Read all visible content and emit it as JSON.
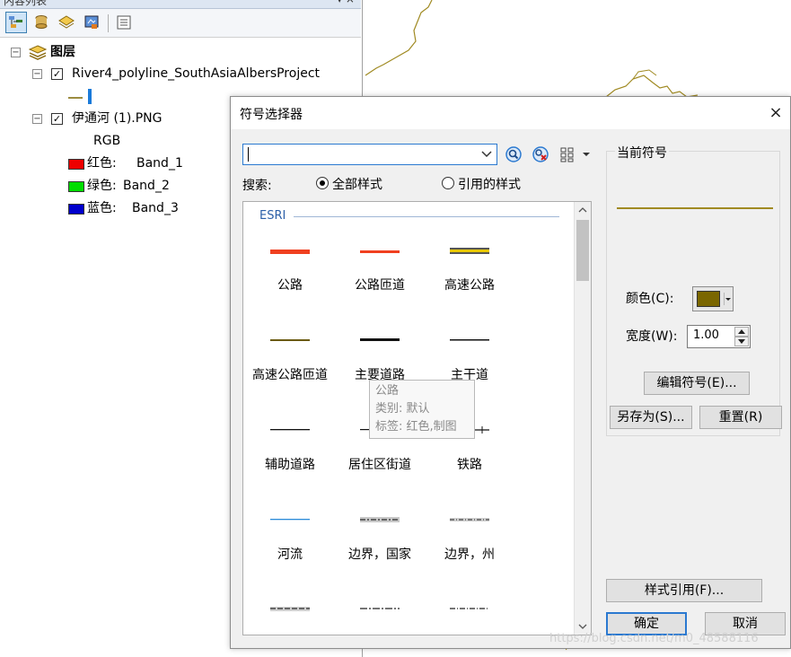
{
  "toc": {
    "title": "内容列表",
    "root_label": "图层",
    "layer1_name": "River4_polyline_SouthAsiaAlbersProject",
    "layer2_name": "伊通河 (1).PNG",
    "rgb_label": "RGB",
    "bands": [
      {
        "label": "红色:",
        "band": "Band_1",
        "color": "#ee0000"
      },
      {
        "label": "绿色:",
        "band": "Band_2",
        "color": "#00dd00"
      },
      {
        "label": "蓝色:",
        "band": "Band_3",
        "color": "#0000cc"
      }
    ]
  },
  "dialog": {
    "title": "符号选择器",
    "close": "×",
    "search_value": "",
    "search_label": "搜索:",
    "radio_all": "全部样式",
    "radio_referenced": "引用的样式",
    "group_name": "ESRI",
    "symbols": [
      {
        "label": "公路"
      },
      {
        "label": "公路匝道"
      },
      {
        "label": "高速公路"
      },
      {
        "label": "高速公路匝道"
      },
      {
        "label": "主要道路"
      },
      {
        "label": "主干道"
      },
      {
        "label": "辅助道路"
      },
      {
        "label": "居住区街道"
      },
      {
        "label": "铁路"
      },
      {
        "label": "河流"
      },
      {
        "label": "边界，国家"
      },
      {
        "label": "边界，州"
      }
    ],
    "tooltip": {
      "line1": "公路",
      "line2": "类别: 默认",
      "line3": "标签: 红色,制图"
    },
    "current_symbol_label": "当前符号",
    "current_color": "#7a6600",
    "color_label": "颜色(C):",
    "width_label": "宽度(W):",
    "width_value": "1.00",
    "edit_symbol": "编辑符号(E)...",
    "save_as": "另存为(S)...",
    "reset": "重置(R)",
    "style_references": "样式引用(F)...",
    "ok": "确定",
    "cancel": "取消"
  },
  "watermark": "https://blog.csdn.net/m0_48588116"
}
